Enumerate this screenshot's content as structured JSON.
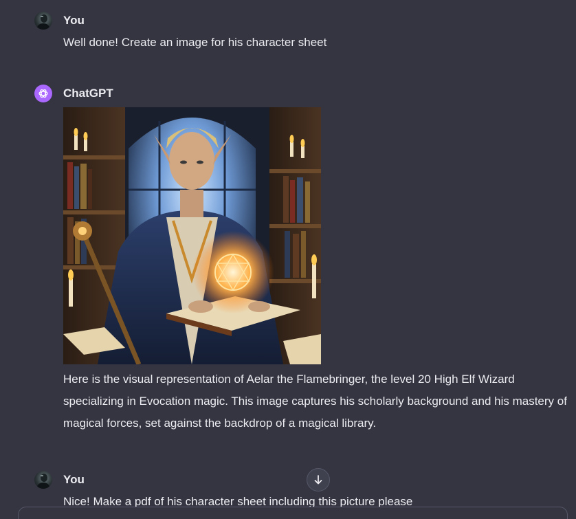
{
  "messages": [
    {
      "author": "You",
      "avatar": "user-avatar",
      "text": "Well done! Create an image for his character sheet"
    },
    {
      "author": "ChatGPT",
      "avatar": "chatgpt-logo-icon",
      "image_alt": "Elf wizard holding a glowing spellbook in a magical library",
      "text": "Here is the visual representation of Aelar the Flamebringer, the level 20 High Elf Wizard specializing in Evocation magic. This image captures his scholarly background and his mastery of magical forces, set against the backdrop of a magical library."
    },
    {
      "author": "You",
      "avatar": "user-avatar",
      "text": "Nice! Make a pdf of his character sheet including this picture please"
    }
  ],
  "controls": {
    "scroll_down_icon": "arrow-down-icon"
  },
  "colors": {
    "background": "#343541",
    "text": "#ececf1",
    "chatgpt_avatar": "#ab68ff"
  }
}
